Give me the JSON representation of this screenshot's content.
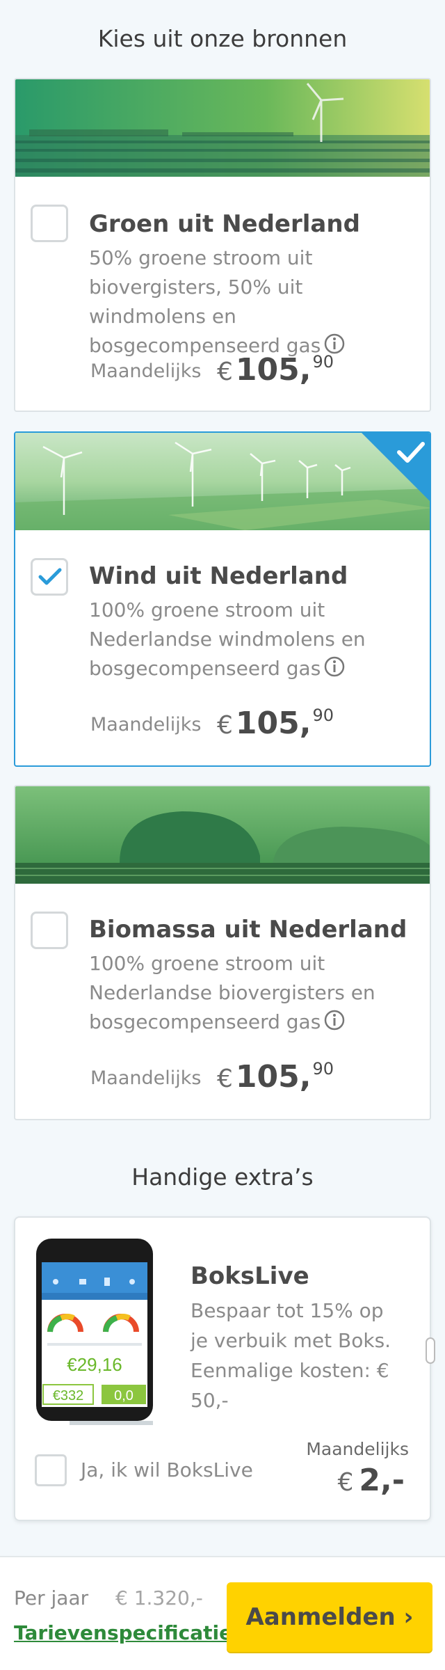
{
  "sources": {
    "title": "Kies uit onze bronnen",
    "cards": [
      {
        "title": "Groen uit Nederland",
        "description": "50% groene stroom uit biovergisters, 50% uit windmolens en bosgecompenseerd gas",
        "price_label": "Maandelijks",
        "currency": "€",
        "price_whole": "105,",
        "price_cents": "90",
        "selected": false,
        "image": "solar-and-wind-field"
      },
      {
        "title": "Wind uit Nederland",
        "description": "100% groene stroom uit Nederlandse windmolens en bosgecompenseerd gas",
        "price_label": "Maandelijks",
        "currency": "€",
        "price_whole": "105,",
        "price_cents": "90",
        "selected": true,
        "image": "wind-turbines-field"
      },
      {
        "title": "Biomassa uit Nederland",
        "description": "100% groene stroom uit Nederlandse biovergisters en bosgecompenseerd gas",
        "price_label": "Maandelijks",
        "currency": "€",
        "price_whole": "105,",
        "price_cents": "90",
        "selected": false,
        "image": "biogas-domes"
      }
    ]
  },
  "extras": {
    "title": "Handige extra’s",
    "item": {
      "title": "BoksLive",
      "description": "Bespaar tot 15% op je verbuik met Boks. Eenmalige kosten: € 50,-",
      "checkbox_label": "Ja, ik wil BoksLive",
      "price_label": "Maandelijks",
      "currency": "€",
      "price": "2,-",
      "phone_value_main": "€29,16",
      "phone_value_left": "€332",
      "phone_value_right": "0,0"
    }
  },
  "footer": {
    "per_jaar_label": "Per jaar",
    "per_jaar_value": "€ 1.320,-",
    "tarief_link": "Tarievenspecificatie",
    "cta_label": "Aanmelden ›"
  },
  "colors": {
    "accent_blue": "#2a9bd9",
    "cta_yellow": "#ffd200",
    "link_green": "#2e8a3a"
  }
}
